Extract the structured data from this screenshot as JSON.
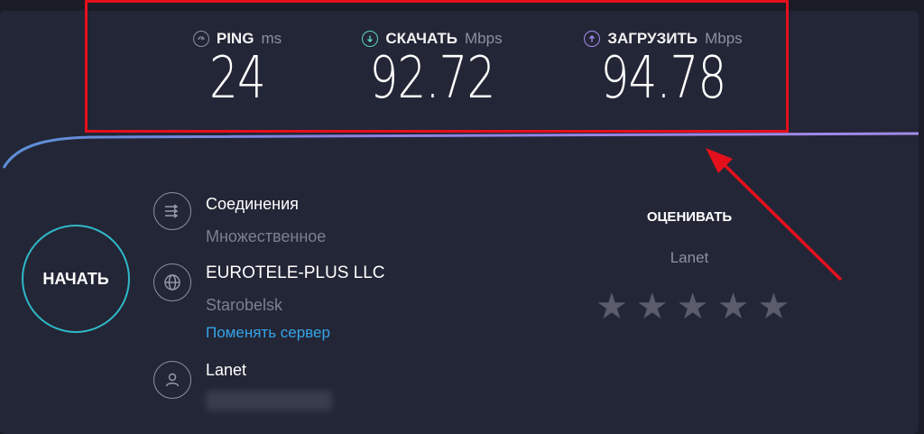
{
  "results": {
    "ping": {
      "label": "PING",
      "unit": "ms",
      "value": "24"
    },
    "download": {
      "label": "СКАЧАТЬ",
      "unit": "Mbps",
      "value": "92.72"
    },
    "upload": {
      "label": "ЗАГРУЗИТЬ",
      "unit": "Mbps",
      "value": "94.78"
    }
  },
  "start_button": {
    "label": "НАЧАТЬ"
  },
  "connections": {
    "title": "Соединения",
    "value": "Множественное"
  },
  "server": {
    "name": "EUROTELE-PLUS LLC",
    "location": "Starobelsk",
    "change_link": "Поменять сервер"
  },
  "user": {
    "isp": "Lanet"
  },
  "rating": {
    "title": "ОЦЕНИВАТЬ",
    "isp": "Lanet",
    "stars": [
      "★",
      "★",
      "★",
      "★",
      "★"
    ]
  },
  "colors": {
    "highlight": "#e4101c",
    "accent": "#2fb8c8",
    "link": "#35a4e8",
    "star": "#5a5c6c"
  },
  "icons": {
    "ping": "ping-gauge-icon",
    "download": "download-arrow-icon",
    "upload": "upload-arrow-icon"
  }
}
